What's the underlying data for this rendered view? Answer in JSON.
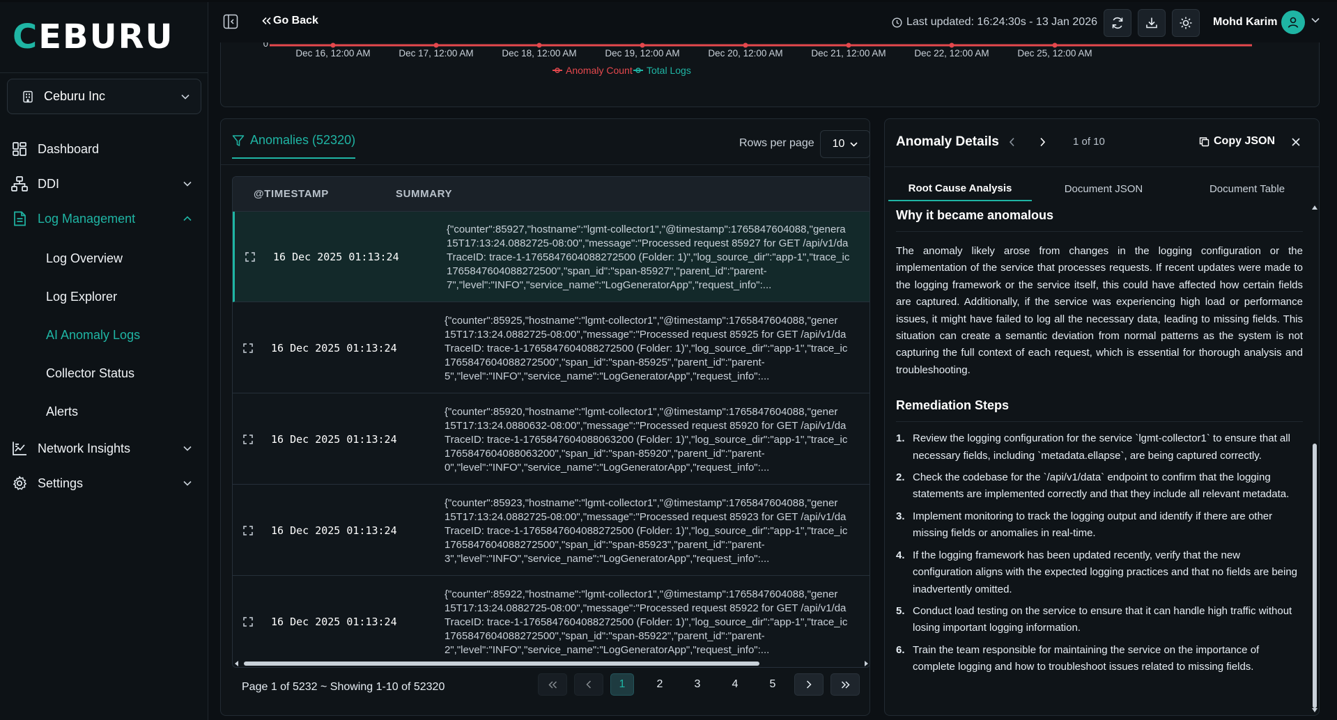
{
  "brand": {
    "logo_text": "CEBURU",
    "accent": "#1fb5a4"
  },
  "org_selector": {
    "label": "Ceburu Inc"
  },
  "nav": {
    "dashboard": "Dashboard",
    "ddi": "DDI",
    "log_management": "Log Management",
    "log_sub": [
      "Log Overview",
      "Log Explorer",
      "AI Anomaly Logs",
      "Collector Status",
      "Alerts"
    ],
    "network_insights": "Network Insights",
    "settings": "Settings"
  },
  "header": {
    "go_back": "Go Back",
    "last_updated": "Last updated: 16:24:30s - 13 Jan 2026",
    "user_name": "Mohd Karim"
  },
  "chart_data": {
    "type": "line",
    "x": [
      "Dec 16, 12:00 AM",
      "Dec 17, 12:00 AM",
      "Dec 18, 12:00 AM",
      "Dec 19, 12:00 AM",
      "Dec 20, 12:00 AM",
      "Dec 21, 12:00 AM",
      "Dec 22, 12:00 AM",
      "Dec 25, 12:00 AM"
    ],
    "y_tick_visible": "0",
    "series": [
      {
        "name": "Anomaly Count",
        "color": "#e5484d"
      },
      {
        "name": "Total Logs",
        "color": "#1fb5a4"
      }
    ],
    "legend_position": "bottom-center"
  },
  "anomalies": {
    "tab_label": "Anomalies (52320)",
    "rows_per_page_label": "Rows per page",
    "rows_per_page_value": "10",
    "columns": [
      "@TIMESTAMP",
      "SUMMARY"
    ],
    "rows": [
      {
        "timestamp": "16 Dec 2025 01:13:24",
        "summary": [
          "{\"counter\":85927,\"hostname\":\"lgmt-collector1\",\"@timestamp\":1765847604088,\"genera",
          "15T17:13:24.0882725-08:00\",\"message\":\"Processed request 85927 for GET /api/v1/da",
          "TraceID: trace-1-1765847604088272500 (Folder: 1)\",\"log_source_dir\":\"app-1\",\"trace_ic",
          "1765847604088272500\",\"span_id\":\"span-85927\",\"parent_id\":\"parent-",
          "7\",\"level\":\"INFO\",\"service_name\":\"LogGeneratorApp\",\"request_info\":..."
        ]
      },
      {
        "timestamp": "16 Dec 2025 01:13:24",
        "summary": [
          "{\"counter\":85925,\"hostname\":\"lgmt-collector1\",\"@timestamp\":1765847604088,\"gener",
          "15T17:13:24.0882725-08:00\",\"message\":\"Processed request 85925 for GET /api/v1/da",
          "TraceID: trace-1-1765847604088272500 (Folder: 1)\",\"log_source_dir\":\"app-1\",\"trace_ic",
          "1765847604088272500\",\"span_id\":\"span-85925\",\"parent_id\":\"parent-",
          "5\",\"level\":\"INFO\",\"service_name\":\"LogGeneratorApp\",\"request_info\":..."
        ]
      },
      {
        "timestamp": "16 Dec 2025 01:13:24",
        "summary": [
          "{\"counter\":85920,\"hostname\":\"lgmt-collector1\",\"@timestamp\":1765847604088,\"gener",
          "15T17:13:24.0880632-08:00\",\"message\":\"Processed request 85920 for GET /api/v1/da",
          "TraceID: trace-1-1765847604088063200 (Folder: 1)\",\"log_source_dir\":\"app-1\",\"trace_ic",
          "1765847604088063200\",\"span_id\":\"span-85920\",\"parent_id\":\"parent-",
          "0\",\"level\":\"INFO\",\"service_name\":\"LogGeneratorApp\",\"request_info\":..."
        ]
      },
      {
        "timestamp": "16 Dec 2025 01:13:24",
        "summary": [
          "{\"counter\":85923,\"hostname\":\"lgmt-collector1\",\"@timestamp\":1765847604088,\"gener",
          "15T17:13:24.0882725-08:00\",\"message\":\"Processed request 85923 for GET /api/v1/da",
          "TraceID: trace-1-1765847604088272500 (Folder: 1)\",\"log_source_dir\":\"app-1\",\"trace_ic",
          "1765847604088272500\",\"span_id\":\"span-85923\",\"parent_id\":\"parent-",
          "3\",\"level\":\"INFO\",\"service_name\":\"LogGeneratorApp\",\"request_info\":..."
        ]
      },
      {
        "timestamp": "16 Dec 2025 01:13:24",
        "summary": [
          "{\"counter\":85922,\"hostname\":\"lgmt-collector1\",\"@timestamp\":1765847604088,\"gener",
          "15T17:13:24.0882725-08:00\",\"message\":\"Processed request 85922 for GET /api/v1/da",
          "TraceID: trace-1-1765847604088272500 (Folder: 1)\",\"log_source_dir\":\"app-1\",\"trace_ic",
          "1765847604088272500\",\"span_id\":\"span-85922\",\"parent_id\":\"parent-",
          "2\",\"level\":\"INFO\",\"service_name\":\"LogGeneratorApp\",\"request_info\":..."
        ]
      }
    ],
    "pagination": {
      "summary": "Page 1 of 5232 ~ Showing 1-10 of 52320",
      "pages": [
        "1",
        "2",
        "3",
        "4",
        "5"
      ],
      "current": "1"
    }
  },
  "details": {
    "title": "Anomaly Details",
    "count": "1 of 10",
    "copy_json": "Copy JSON",
    "tabs": [
      "Root Cause Analysis",
      "Document JSON",
      "Document Table"
    ],
    "why_heading": "Why it became anomalous",
    "why_text": "The anomaly likely arose from changes in the logging configuration or the implementation of the service that processes requests. If recent updates were made to the logging framework or the service itself, this could have affected how certain fields are captured. Additionally, if the service was experiencing high load or performance issues, it might have failed to log all the necessary data, leading to missing fields. This situation can create a semantic deviation from normal patterns as the system is not capturing the full context of each request, which is essential for thorough analysis and troubleshooting.",
    "remediation_heading": "Remediation Steps",
    "steps": [
      "Review the logging configuration for the service `lgmt-collector1` to ensure that all necessary fields, including `metadata.ellapse`, are being captured correctly.",
      "Check the codebase for the `/api/v1/data` endpoint to confirm that the logging statements are implemented correctly and that they include all relevant metadata.",
      "Implement monitoring to track the logging output and identify if there are other missing fields or anomalies in real-time.",
      "If the logging framework has been updated recently, verify that the new configuration aligns with the expected logging practices and that no fields are being inadvertently omitted.",
      "Conduct load testing on the service to ensure that it can handle high traffic without losing important logging information.",
      "Train the team responsible for maintaining the service on the importance of complete logging and how to troubleshoot issues related to missing fields."
    ]
  }
}
